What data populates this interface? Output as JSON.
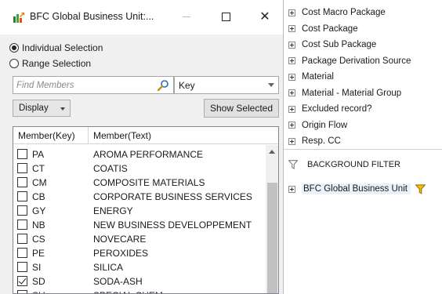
{
  "dialog": {
    "title": "BFC Global Business Unit:...",
    "minimize_label": "",
    "close_label": "✕",
    "selection_modes": [
      {
        "label": "Individual Selection",
        "selected": true
      },
      {
        "label": "Range Selection",
        "selected": false
      }
    ],
    "search": {
      "placeholder": "Find Members",
      "value": ""
    },
    "search_field": {
      "value": "Key"
    },
    "display_label": "Display",
    "show_selected_label": "Show Selected",
    "columns": {
      "key": "Member(Key)",
      "text": "Member(Text)"
    },
    "members": [
      {
        "key": "PA",
        "text": "AROMA PERFORMANCE",
        "checked": false
      },
      {
        "key": "CT",
        "text": "COATIS",
        "checked": false
      },
      {
        "key": "CM",
        "text": "COMPOSITE MATERIALS",
        "checked": false
      },
      {
        "key": "CB",
        "text": "CORPORATE BUSINESS SERVICES",
        "checked": false
      },
      {
        "key": "GY",
        "text": "ENERGY",
        "checked": false
      },
      {
        "key": "NB",
        "text": "NEW BUSINESS DEVELOPPEMENT",
        "checked": false
      },
      {
        "key": "CS",
        "text": "NOVECARE",
        "checked": false
      },
      {
        "key": "PE",
        "text": "PEROXIDES",
        "checked": false
      },
      {
        "key": "SI",
        "text": "SILICA",
        "checked": false
      },
      {
        "key": "SD",
        "text": "SODA-ASH",
        "checked": true
      },
      {
        "key": "SU",
        "text": "SPECIAL CHEM",
        "checked": false
      }
    ]
  },
  "tree": {
    "items": [
      "Cost Macro Package",
      "Cost Package",
      "Cost Sub Package",
      "Package Derivation Source",
      "Material",
      "Material - Material Group",
      "Excluded record?",
      "Origin Flow",
      "Resp. CC"
    ],
    "background_filter_label": "BACKGROUND FILTER",
    "filter_item": "BFC Global Business Unit"
  },
  "colors": {
    "filter_funnel": "#f2c200",
    "selected_row": "#eaf1fb"
  }
}
